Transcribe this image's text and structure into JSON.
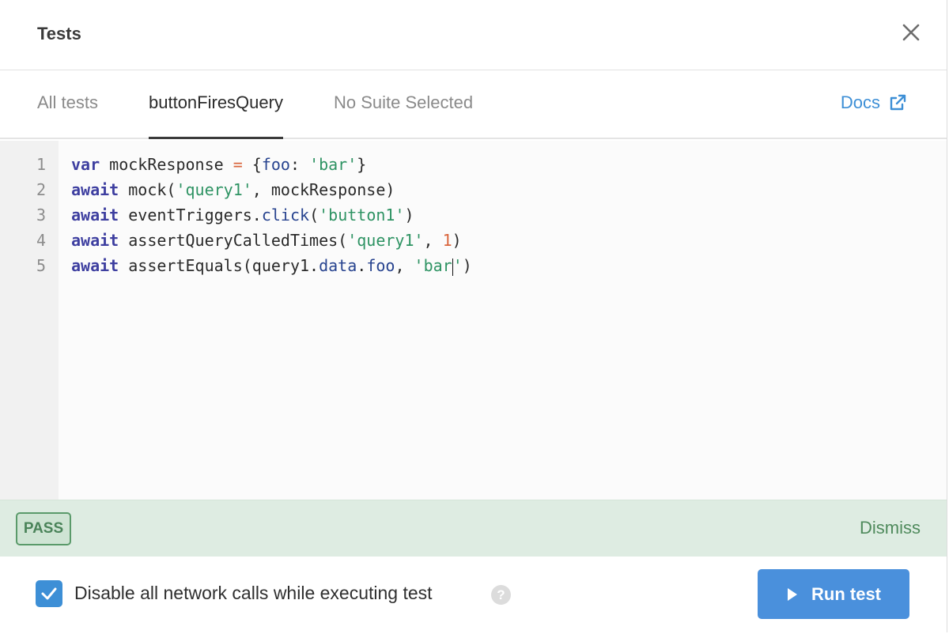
{
  "header": {
    "title": "Tests"
  },
  "tabs": [
    {
      "label": "All tests",
      "active": false
    },
    {
      "label": "buttonFiresQuery",
      "active": true
    },
    {
      "label": "No Suite Selected",
      "active": false
    }
  ],
  "docs": {
    "label": "Docs"
  },
  "editor": {
    "line_numbers": [
      "1",
      "2",
      "3",
      "4",
      "5"
    ],
    "lines": [
      [
        {
          "t": "var",
          "c": "kw"
        },
        {
          "t": " mockResponse ",
          "c": ""
        },
        {
          "t": "=",
          "c": "op"
        },
        {
          "t": " {",
          "c": ""
        },
        {
          "t": "foo",
          "c": "prop"
        },
        {
          "t": ": ",
          "c": ""
        },
        {
          "t": "'bar'",
          "c": "str"
        },
        {
          "t": "}",
          "c": ""
        }
      ],
      [
        {
          "t": "await",
          "c": "kw"
        },
        {
          "t": " mock(",
          "c": ""
        },
        {
          "t": "'query1'",
          "c": "str"
        },
        {
          "t": ", mockResponse)",
          "c": ""
        }
      ],
      [
        {
          "t": "await",
          "c": "kw"
        },
        {
          "t": " eventTriggers.",
          "c": ""
        },
        {
          "t": "click",
          "c": "prop"
        },
        {
          "t": "(",
          "c": ""
        },
        {
          "t": "'button1'",
          "c": "str"
        },
        {
          "t": ")",
          "c": ""
        }
      ],
      [
        {
          "t": "await",
          "c": "kw"
        },
        {
          "t": " assertQueryCalledTimes(",
          "c": ""
        },
        {
          "t": "'query1'",
          "c": "str"
        },
        {
          "t": ", ",
          "c": ""
        },
        {
          "t": "1",
          "c": "num"
        },
        {
          "t": ")",
          "c": ""
        }
      ],
      [
        {
          "t": "await",
          "c": "kw"
        },
        {
          "t": " assertEquals(query1.",
          "c": ""
        },
        {
          "t": "data",
          "c": "prop"
        },
        {
          "t": ".",
          "c": ""
        },
        {
          "t": "foo",
          "c": "prop"
        },
        {
          "t": ", ",
          "c": ""
        },
        {
          "t": "'bar",
          "c": "str"
        },
        {
          "t": "|caret|",
          "c": "caret"
        },
        {
          "t": "'",
          "c": "str"
        },
        {
          "t": ")",
          "c": ""
        }
      ]
    ]
  },
  "result": {
    "status": "PASS",
    "dismiss_label": "Dismiss"
  },
  "footer": {
    "checkbox_label": "Disable all network calls while executing test",
    "checkbox_checked": true,
    "help": "?",
    "run_label": "Run test"
  },
  "colors": {
    "accent": "#3d8fd6",
    "pass_bg": "#deece2",
    "pass_text": "#4a8359"
  },
  "icons": {
    "close": "close-icon",
    "docs": "external-link-icon",
    "check": "check-icon",
    "run": "play-icon",
    "help": "help-icon"
  }
}
